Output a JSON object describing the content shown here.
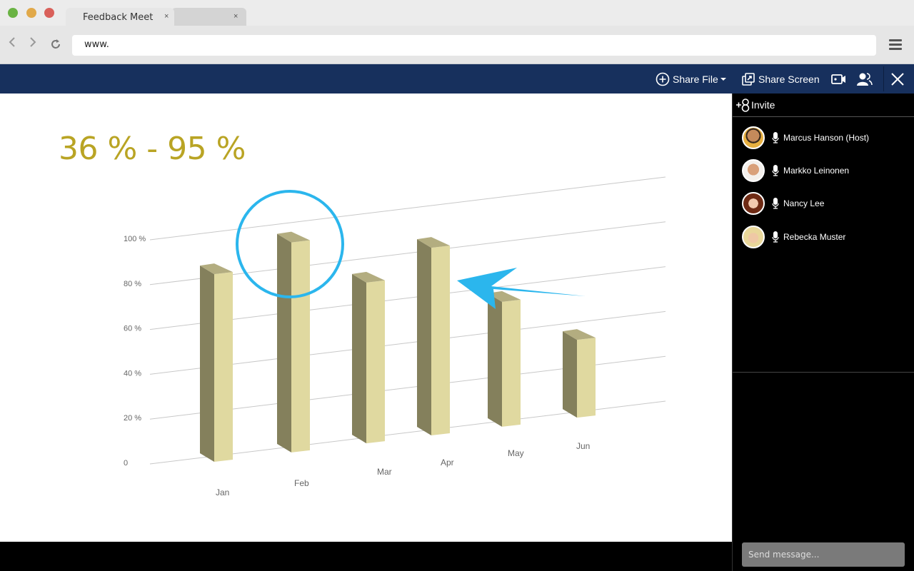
{
  "browser": {
    "tabs": [
      {
        "label": "Feedback Meet",
        "close": "×"
      },
      {
        "label": "",
        "close": "×"
      }
    ],
    "url": "www.",
    "traffic_lights": {
      "green": "#6ab344",
      "yellow": "#e1a94a",
      "red": "#d9605a"
    }
  },
  "toolbar": {
    "share_file_label": "Share File",
    "share_screen_label": "Share Screen",
    "bg_color": "#17305d"
  },
  "slide": {
    "range_title": "36 % - 95 %",
    "annotation_color": "#2bb6ed"
  },
  "chart_data": {
    "type": "bar",
    "style": "3d-column",
    "title": "36 % - 95 %",
    "categories": [
      "Jan",
      "Feb",
      "Mar",
      "Apr",
      "May",
      "Jun"
    ],
    "values": [
      85,
      95,
      73,
      85,
      57,
      36
    ],
    "yticks": [
      "0",
      "20 %",
      "40 %",
      "60 %",
      "80 %",
      "100 %"
    ],
    "ylim": [
      0,
      100
    ],
    "xlabel": "",
    "ylabel": "",
    "grid": true,
    "highlighted_category": "Feb",
    "colors": {
      "front": "#e0d9a0",
      "side": "#84805c",
      "top": "#b3ad80"
    }
  },
  "sidebar": {
    "invite_label": "Invite",
    "participants": [
      {
        "name": "Marcus Hanson (Host)"
      },
      {
        "name": "Markko Leinonen"
      },
      {
        "name": "Nancy Lee"
      },
      {
        "name": "Rebecka Muster"
      }
    ],
    "message_placeholder": "Send message..."
  }
}
